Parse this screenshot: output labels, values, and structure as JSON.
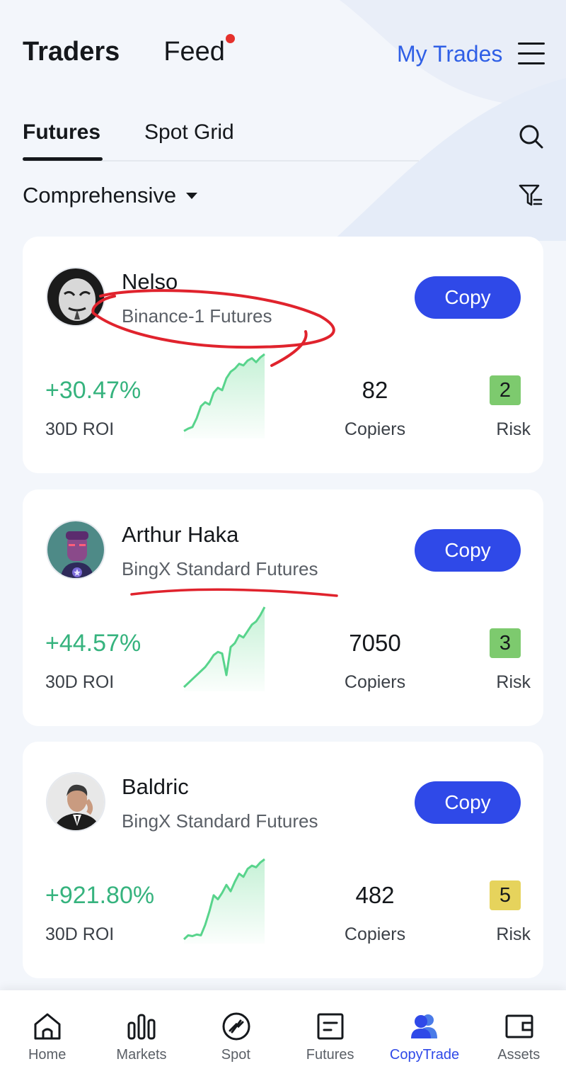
{
  "header": {
    "tabs": [
      {
        "label": "Traders"
      },
      {
        "label": "Feed"
      }
    ],
    "my_trades": "My Trades"
  },
  "subtabs": [
    {
      "label": "Futures"
    },
    {
      "label": "Spot Grid"
    }
  ],
  "sort": {
    "label": "Comprehensive"
  },
  "cards": [
    {
      "name": "Nelso",
      "source": "Binance-1 Futures",
      "copy_label": "Copy",
      "roi": "+30.47%",
      "roi_label": "30D ROI",
      "copiers": "82",
      "copiers_label": "Copiers",
      "risk": "2",
      "risk_label": "Risk",
      "risk_color": "#7dca6e",
      "trend": [
        0.04,
        0.07,
        0.09,
        0.2,
        0.35,
        0.4,
        0.37,
        0.52,
        0.58,
        0.55,
        0.7,
        0.78,
        0.82,
        0.88,
        0.86,
        0.92,
        0.95,
        0.9,
        0.96,
        1.0
      ]
    },
    {
      "name": "Arthur Haka",
      "source": "BingX Standard Futures",
      "copy_label": "Copy",
      "roi": "+44.57%",
      "roi_label": "30D ROI",
      "copiers": "7050",
      "copiers_label": "Copiers",
      "risk": "3",
      "risk_label": "Risk",
      "risk_color": "#7dca6e",
      "trend": [
        0.0,
        0.05,
        0.1,
        0.15,
        0.2,
        0.25,
        0.32,
        0.4,
        0.44,
        0.42,
        0.15,
        0.5,
        0.55,
        0.65,
        0.62,
        0.7,
        0.78,
        0.82,
        0.9,
        1.0
      ]
    },
    {
      "name": "Baldric",
      "source": "BingX Standard Futures",
      "copy_label": "Copy",
      "roi": "+921.80%",
      "roi_label": "30D ROI",
      "copiers": "482",
      "copiers_label": "Copiers",
      "risk": "5",
      "risk_label": "Risk",
      "risk_color": "#e6d35c",
      "trend": [
        0.0,
        0.05,
        0.04,
        0.06,
        0.05,
        0.18,
        0.35,
        0.55,
        0.5,
        0.58,
        0.68,
        0.6,
        0.72,
        0.82,
        0.78,
        0.88,
        0.92,
        0.9,
        0.96,
        1.0
      ]
    }
  ],
  "nav": [
    {
      "label": "Home",
      "icon": "home-icon"
    },
    {
      "label": "Markets",
      "icon": "bar-chart-icon"
    },
    {
      "label": "Spot",
      "icon": "spot-icon"
    },
    {
      "label": "Futures",
      "icon": "futures-icon"
    },
    {
      "label": "CopyTrade",
      "icon": "copytrade-icon"
    },
    {
      "label": "Assets",
      "icon": "wallet-icon"
    }
  ],
  "colors": {
    "accent": "#2f49e8",
    "positive": "#36b37e",
    "link": "#2f5fe6",
    "annotation": "#e0232d"
  }
}
